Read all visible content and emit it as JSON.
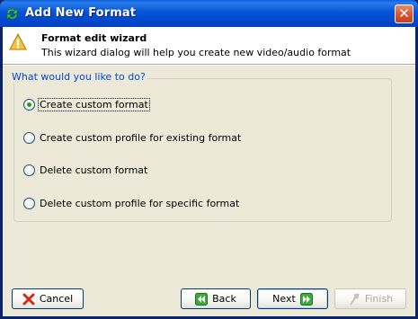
{
  "window": {
    "title": "Add New Format",
    "accent": "#0453D6"
  },
  "header": {
    "title": "Format edit wizard",
    "subtitle": "This wizard dialog will help you create new video/audio format",
    "icon": "info-icon"
  },
  "group": {
    "label": "What would you like to do?"
  },
  "options": [
    {
      "label": "Create custom format",
      "selected": true
    },
    {
      "label": "Create custom profile for existing format",
      "selected": false
    },
    {
      "label": "Delete custom format",
      "selected": false
    },
    {
      "label": "Delete custom profile for specific format",
      "selected": false
    }
  ],
  "buttons": {
    "cancel": "Cancel",
    "back": "Back",
    "next": "Next",
    "finish": "Finish"
  }
}
